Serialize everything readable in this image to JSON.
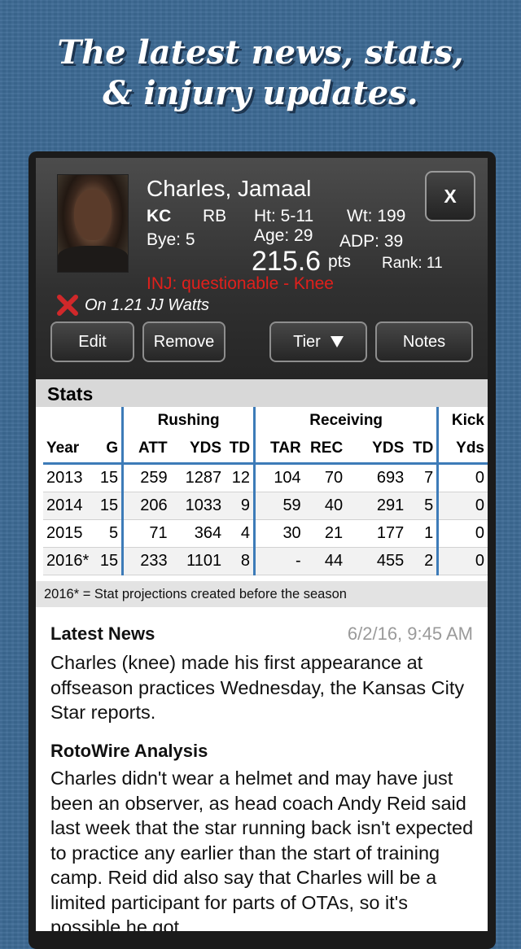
{
  "promo": {
    "headline_line1": "The latest news, stats,",
    "headline_line2": "& injury updates."
  },
  "player": {
    "name": "Charles, Jamaal",
    "team": "KC",
    "position": "RB",
    "height": "Ht: 5-11",
    "weight": "Wt: 199",
    "bye": "Bye: 5",
    "age": "Age: 29",
    "adp": "ADP: 39",
    "points": "215.6",
    "points_unit": "pts",
    "rank": "Rank: 11",
    "injury": "INJ: questionable - Knee",
    "roster_status": "On 1.21 JJ Watts",
    "close_label": "X"
  },
  "actions": {
    "edit": "Edit",
    "remove": "Remove",
    "tier": "Tier",
    "notes": "Notes"
  },
  "stats": {
    "title": "Stats",
    "groups": {
      "rushing": "Rushing",
      "receiving": "Receiving",
      "kick": "Kick"
    },
    "columns": [
      "Year",
      "G",
      "ATT",
      "YDS",
      "TD",
      "TAR",
      "REC",
      "YDS",
      "TD",
      "Yds"
    ],
    "rows": [
      [
        "2013",
        "15",
        "259",
        "1287",
        "12",
        "104",
        "70",
        "693",
        "7",
        "0"
      ],
      [
        "2014",
        "15",
        "206",
        "1033",
        "9",
        "59",
        "40",
        "291",
        "5",
        "0"
      ],
      [
        "2015",
        "5",
        "71",
        "364",
        "4",
        "30",
        "21",
        "177",
        "1",
        "0"
      ],
      [
        "2016*",
        "15",
        "233",
        "1101",
        "8",
        "-",
        "44",
        "455",
        "2",
        "0"
      ]
    ],
    "footnote": "2016* = Stat projections created before the season"
  },
  "news": {
    "heading": "Latest News",
    "date": "6/2/16, 9:45 AM",
    "body": "Charles (knee) made his first appearance at offseason practices Wednesday, the Kansas City Star reports."
  },
  "analysis": {
    "heading": "RotoWire Analysis",
    "body": "Charles didn't wear a helmet and may have just been an observer, as head coach Andy Reid said last week that the star running back isn't expected to practice any earlier than the start of training camp. Reid did also say that Charles will be a limited participant for parts of OTAs, so it's possible he got"
  },
  "colors": {
    "background": "#3d6b95",
    "accent": "#3d7bb8",
    "injury": "#e0201c",
    "remove_x": "#d0282a"
  }
}
